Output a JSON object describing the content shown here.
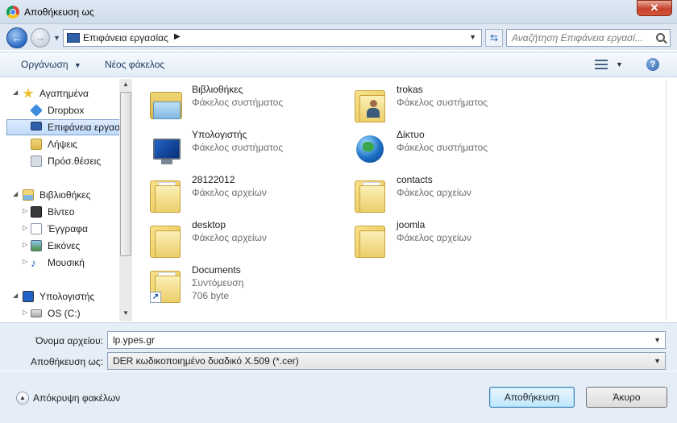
{
  "window": {
    "title": "Αποθήκευση ως"
  },
  "nav": {
    "path": "Επιφάνεια εργασίας",
    "search_placeholder": "Αναζήτηση Επιφάνεια εργασί..."
  },
  "toolbar": {
    "organize": "Οργάνωση",
    "new_folder": "Νέος φάκελος"
  },
  "sidebar": {
    "items": [
      {
        "label": "Αγαπημένα",
        "icon": "star-icon"
      },
      {
        "label": "Dropbox",
        "icon": "dropbox-icon"
      },
      {
        "label": "Επιφάνεια εργασ",
        "icon": "desktop-icon"
      },
      {
        "label": "Λήψεις",
        "icon": "downloads-icon"
      },
      {
        "label": "Πρόσ.θέσεις",
        "icon": "recent-places-icon"
      },
      {
        "label": "Βιβλιοθήκες",
        "icon": "libraries-icon"
      },
      {
        "label": "Βίντεο",
        "icon": "video-icon"
      },
      {
        "label": "Έγγραφα",
        "icon": "documents-icon"
      },
      {
        "label": "Εικόνες",
        "icon": "pictures-icon"
      },
      {
        "label": "Μουσική",
        "icon": "music-icon"
      },
      {
        "label": "Υπολογιστής",
        "icon": "computer-icon"
      },
      {
        "label": "OS (C:)",
        "icon": "drive-icon"
      }
    ]
  },
  "files": [
    {
      "name": "Βιβλιοθήκες",
      "type": "Φάκελος συστήματος",
      "icon": "libraries-icon"
    },
    {
      "name": "trokas",
      "type": "Φάκελος συστήματος",
      "icon": "user-folder-icon"
    },
    {
      "name": "Υπολογιστής",
      "type": "Φάκελος συστήματος",
      "icon": "computer-icon"
    },
    {
      "name": "Δίκτυο",
      "type": "Φάκελος συστήματος",
      "icon": "network-icon"
    },
    {
      "name": "28122012",
      "type": "Φάκελος αρχείων",
      "icon": "folder-icon"
    },
    {
      "name": "contacts",
      "type": "Φάκελος αρχείων",
      "icon": "folder-icon"
    },
    {
      "name": "desktop",
      "type": "Φάκελος αρχείων",
      "icon": "folder-icon"
    },
    {
      "name": "joomla",
      "type": "Φάκελος αρχείων",
      "icon": "folder-icon"
    },
    {
      "name": "Documents",
      "type": "Συντόμευση",
      "size": "706 byte",
      "icon": "shortcut-folder-icon"
    }
  ],
  "form": {
    "filename_label": "Όνομα αρχείου:",
    "filename_value": "lp.ypes.gr",
    "savetype_label": "Αποθήκευση ως:",
    "savetype_value": "DER κωδικοποιημένο δυαδικό X.509 (*.cer)"
  },
  "footer": {
    "hide_folders": "Απόκρυψη φακέλων",
    "save": "Αποθήκευση",
    "cancel": "Άκυρο"
  }
}
